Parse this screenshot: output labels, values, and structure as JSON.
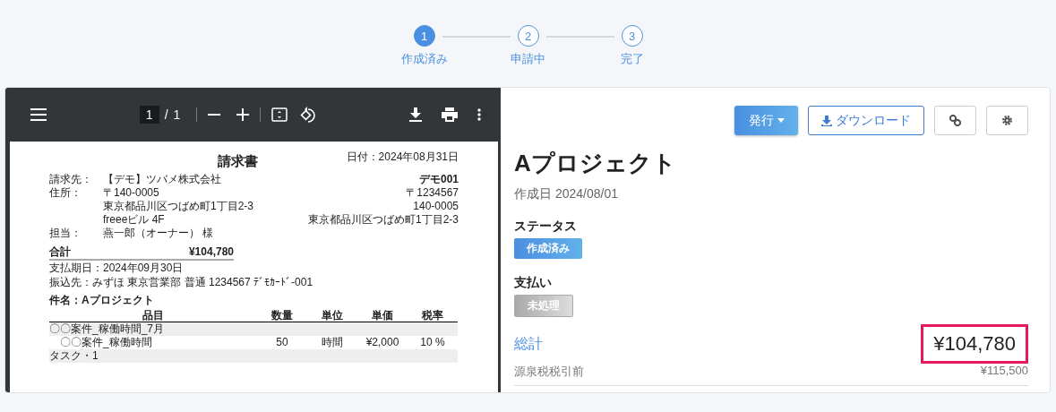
{
  "steps": [
    {
      "number": "1",
      "label": "作成済み",
      "selected": true
    },
    {
      "number": "2",
      "label": "申請中",
      "selected": false
    },
    {
      "number": "3",
      "label": "完了",
      "selected": false
    }
  ],
  "viewer": {
    "toolbar": {
      "page": "1",
      "separator": "/",
      "total": "1"
    },
    "document": {
      "title": "請求書",
      "date": "日付：2024年08月31日",
      "recipient": [
        {
          "label": "請求先：",
          "lines": [
            "【デモ】ツバメ株式会社"
          ]
        },
        {
          "label": "住所：",
          "lines": [
            "〒140-0005",
            "東京都品川区つばめ町1丁目2-3",
            "freeeビル 4F"
          ]
        },
        {
          "label": "担当：",
          "lines": [
            "燕一郎（オーナー） 様"
          ]
        }
      ],
      "issuer": {
        "name": "デモ001",
        "lines": [
          "〒1234567",
          "140-0005",
          "東京都品川区つばめ町1丁目2-3"
        ]
      },
      "total": {
        "label": "合計",
        "value": "¥104,780"
      },
      "notes": [
        "支払期日：2024年09月30日",
        "振込先：みずほ 東京営業部 普通 1234567 ﾃﾞﾓｶｰﾄﾞ-001"
      ],
      "subject": "件名：Aプロジェクト",
      "table": {
        "columns": [
          "品目",
          "数量",
          "単位",
          "単価",
          "税率"
        ],
        "rows": [
          {
            "kind": "group",
            "cells": [
              "〇〇案件_稼働時間_7月"
            ]
          },
          {
            "kind": "item",
            "cells": [
              "〇〇案件_稼働時間",
              "50",
              "時間",
              "¥2,000",
              "10 %"
            ]
          },
          {
            "kind": "group",
            "cells": [
              "タスク・1"
            ]
          }
        ]
      }
    }
  },
  "detail": {
    "buttons": [
      {
        "kind": "primary",
        "label": "発行"
      },
      {
        "kind": "outline",
        "label": "ダウンロード"
      },
      {
        "kind": "link"
      },
      {
        "kind": "settings"
      }
    ],
    "title": "Aプロジェクト",
    "created": "作成日 2024/08/01",
    "fields": [
      {
        "label": "ステータス",
        "badge": "作成済み",
        "kind": "primary"
      },
      {
        "label": "支払い",
        "badge": "未処理",
        "kind": "muted"
      }
    ],
    "total": {
      "label": "総計",
      "value": "¥104,780",
      "highlighted": true
    },
    "pre_tax": {
      "label": "源泉税税引前",
      "value": "¥115,500"
    }
  }
}
